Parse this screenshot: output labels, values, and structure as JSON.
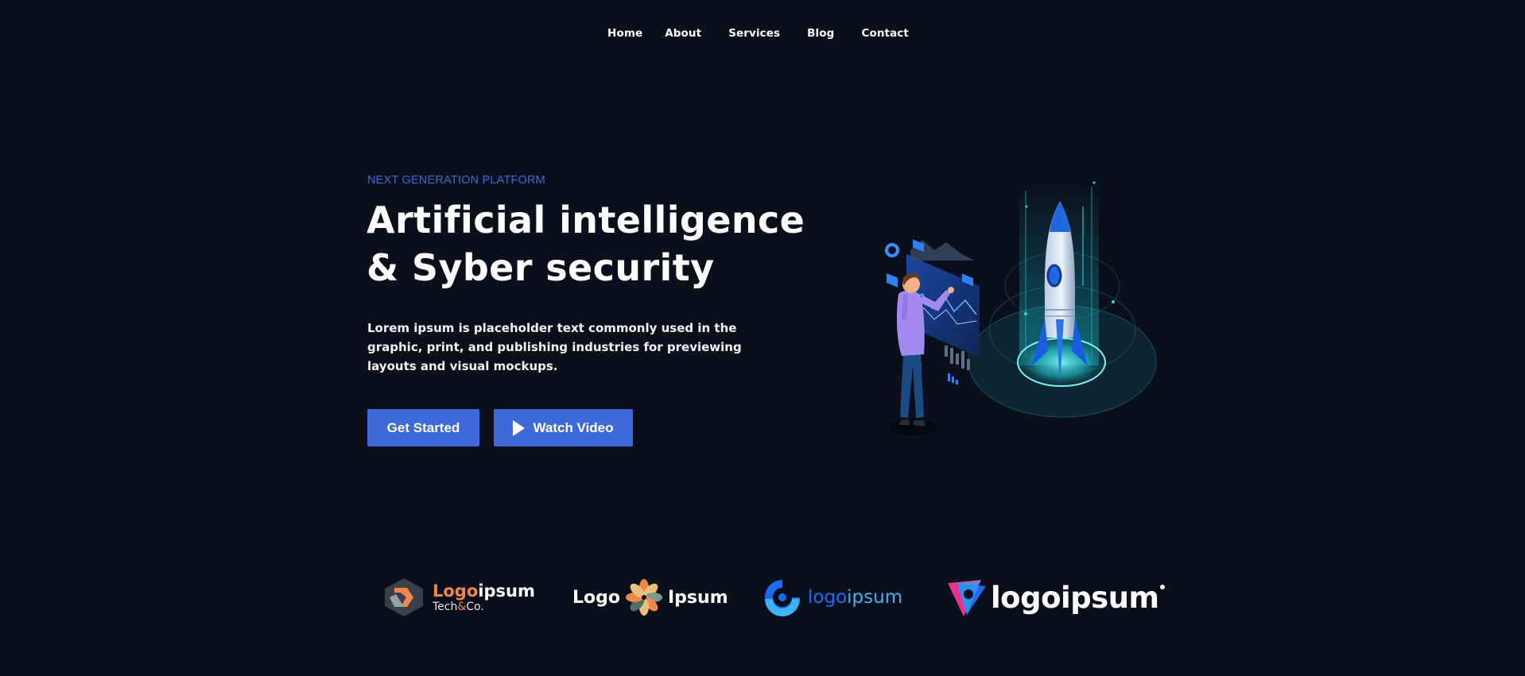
{
  "nav": {
    "items": [
      {
        "label": "Home"
      },
      {
        "label": "About"
      },
      {
        "label": "Services"
      },
      {
        "label": "Blog"
      },
      {
        "label": "Contact"
      }
    ]
  },
  "hero": {
    "eyebrow": "NEXT GENERATION PLATFORM",
    "title_line1": "Artificial intelligence",
    "title_line2": "& Syber security",
    "lead": "Lorem ipsum is placeholder text commonly used in the graphic, print, and publishing industries for previewing layouts and visual mockups.",
    "cta_primary": "Get Started",
    "cta_secondary": "Watch Video"
  },
  "logos": {
    "logo1": {
      "part1": "Logo",
      "part2": "ipsum",
      "sub1": "Tech",
      "sub_amp": "&",
      "sub2": "Co."
    },
    "logo2": {
      "left": "Logo",
      "right": "Ipsum"
    },
    "logo3": {
      "part1": "logo",
      "part2": "ipsum"
    },
    "logo4": {
      "text": "logoipsum"
    }
  },
  "colors": {
    "background": "#0a0f1b",
    "accent": "#3d6ad8",
    "logo_orange": "#f0864a",
    "logo_blue": "#1a6cf0",
    "logo_cyan": "#3fb1f4"
  },
  "icons": {
    "play": "play-icon",
    "illustration": "rocket-illustration"
  }
}
